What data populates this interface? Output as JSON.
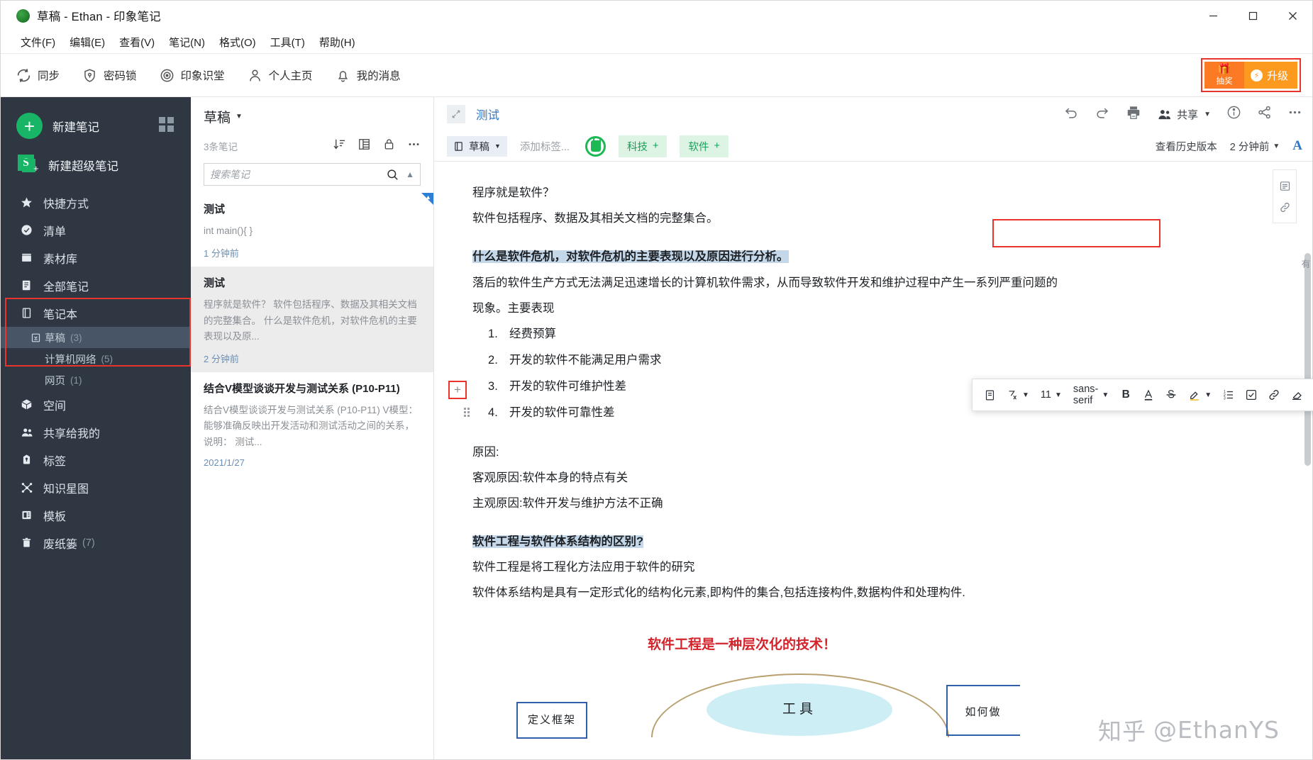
{
  "window": {
    "title": "草稿 - Ethan - 印象笔记",
    "minimize": "─",
    "maximize": "☐",
    "close": "✕"
  },
  "menubar": {
    "items": [
      {
        "label": "文件(F)"
      },
      {
        "label": "编辑(E)"
      },
      {
        "label": "查看(V)"
      },
      {
        "label": "笔记(N)"
      },
      {
        "label": "格式(O)"
      },
      {
        "label": "工具(T)"
      },
      {
        "label": "帮助(H)"
      }
    ]
  },
  "toolbar": {
    "items": [
      {
        "label": "同步",
        "icon": "sync-icon"
      },
      {
        "label": "密码锁",
        "icon": "shield-lock-icon"
      },
      {
        "label": "印象识堂",
        "icon": "target-icon"
      },
      {
        "label": "个人主页",
        "icon": "person-icon"
      },
      {
        "label": "我的消息",
        "icon": "bell-icon"
      }
    ],
    "gift_label": "抽奖",
    "upgrade_label": "升级",
    "highlight_color": "#e8342a"
  },
  "sidebar": {
    "new_note": "新建笔记",
    "new_super_note": "新建超级笔记",
    "super_badge": "S",
    "items": [
      {
        "label": "快捷方式",
        "icon": "star-icon"
      },
      {
        "label": "清单",
        "icon": "check-circle-icon"
      },
      {
        "label": "素材库",
        "icon": "box-icon"
      },
      {
        "label": "全部笔记",
        "icon": "notes-icon"
      },
      {
        "label": "笔记本",
        "icon": "notebook-icon"
      }
    ],
    "notebooks": [
      {
        "label": "草稿",
        "count": "(3)",
        "active": true,
        "icon": "notebook-save-icon"
      },
      {
        "label": "计算机网络",
        "count": "(5)",
        "active": false
      },
      {
        "label": "网页",
        "count": "(1)",
        "active": false
      }
    ],
    "items_after": [
      {
        "label": "空间",
        "icon": "cube-icon"
      },
      {
        "label": "共享给我的",
        "icon": "people-icon"
      },
      {
        "label": "标签",
        "icon": "tag-icon"
      },
      {
        "label": "知识星图",
        "icon": "graph-icon"
      },
      {
        "label": "模板",
        "icon": "template-icon"
      },
      {
        "label": "废纸篓",
        "count": "(7)",
        "icon": "trash-icon"
      }
    ]
  },
  "notelist": {
    "title": "草稿",
    "count_text": "3条笔记",
    "search_placeholder": "搜索笔记",
    "actions": [
      {
        "name": "sort-icon"
      },
      {
        "name": "view-mode-icon"
      },
      {
        "name": "lock-icon"
      },
      {
        "name": "more-icon"
      }
    ],
    "notes": [
      {
        "title": "测试",
        "snippet": "int main(){ }",
        "date": "1 分钟前",
        "selected": false,
        "flagged": true
      },
      {
        "title": "测试",
        "snippet": "程序就是软件？ 软件包括程序、数据及其相关文档的完整集合。 什么是软件危机，对软件危机的主要表现以及原...",
        "date": "2 分钟前",
        "selected": true,
        "flagged": false
      },
      {
        "title": "结合V模型谈谈开发与测试关系 (P10-P11)",
        "snippet": "结合V模型谈谈开发与测试关系 (P10-P11) V模型：能够准确反映出开发活动和测试活动之间的关系，说明： 测试...",
        "date": "2021/1/27",
        "selected": false,
        "flagged": false
      }
    ]
  },
  "editor": {
    "title": "测试",
    "notebook_chip": "草稿",
    "add_tag_placeholder": "添加标签...",
    "tags": [
      {
        "label": "科技",
        "plus": "+"
      },
      {
        "label": "软件",
        "plus": "+"
      }
    ],
    "share_label": "共享",
    "history_label": "查看历史版本",
    "time_ago": "2 分钟前",
    "top_icons": [
      {
        "name": "undo-icon"
      },
      {
        "name": "redo-icon"
      },
      {
        "name": "print-icon"
      },
      {
        "name": "info-icon"
      },
      {
        "name": "share-node-icon"
      },
      {
        "name": "more-icon"
      }
    ],
    "format_toolbar": {
      "font_size": "11",
      "font_family": "sans-serif",
      "bold": "B",
      "font_color": "A",
      "strike": "S",
      "buttons": [
        {
          "name": "paragraph-style-icon"
        },
        {
          "name": "clear-format-icon"
        },
        {
          "name": "highlight-icon"
        },
        {
          "name": "ordered-list-icon"
        },
        {
          "name": "checklist-icon"
        },
        {
          "name": "link-icon"
        },
        {
          "name": "eraser-icon"
        },
        {
          "name": "more-icon"
        }
      ]
    },
    "body": {
      "p1": "程序就是软件？",
      "p2": "软件包括程序、数据及其相关文档的完整集合。",
      "h1": "什么是软件危机，对软件危机的主要表现以及原因进行分析。",
      "p3": "落后的软件生产方式无法满足迅速增长的计算机软件需求，从而导致软件开发和维护过程中产生一系列严重问题的",
      "p3b": "现象。主要表现",
      "list": [
        "经费预算",
        "开发的软件不能满足用户需求",
        "开发的软件可维护性差",
        "开发的软件可靠性差"
      ],
      "cause_label": "原因:",
      "cause1": "客观原因:软件本身的特点有关",
      "cause2": "主观原因:软件开发与维护方法不正确",
      "h2": "软件工程与软件体系结构的区别?",
      "p4": "软件工程是将工程化方法应用于软件的研究",
      "p5": "软件体系结构是具有一定形式化的结构化元素,即构件的集合,包括连接构件,数据构件和处理构件.",
      "redtitle": "软件工程是一种层次化的技术！",
      "diagram": {
        "box1": "定义框架",
        "ellipse": "工具",
        "box2": "如何做"
      }
    },
    "right_rail": [
      {
        "name": "outline-icon"
      },
      {
        "name": "link-icon"
      }
    ],
    "far_strip": "有"
  },
  "watermark": {
    "logo": "知乎",
    "handle": "@EthanYS"
  },
  "colors": {
    "accent_green": "#18b566",
    "highlight_red": "#e8342a",
    "sidebar_bg": "#2e3742",
    "link_blue": "#2f76c4",
    "tag_bg": "#ddf4e4"
  }
}
